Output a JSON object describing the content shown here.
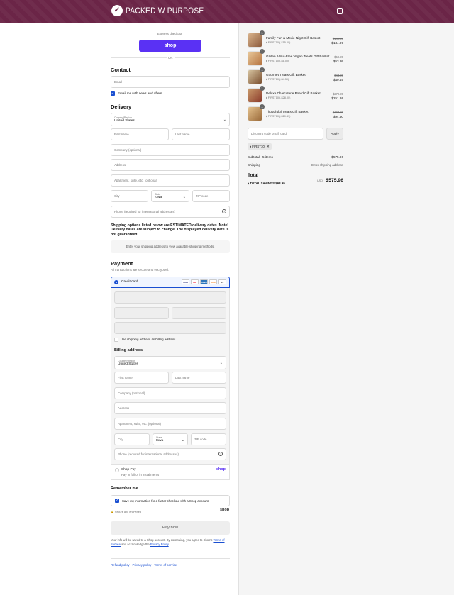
{
  "header": {
    "brand": "PACKED W PURPOSE"
  },
  "express": {
    "label": "Express checkout",
    "shop_button": "shop",
    "or": "OR"
  },
  "contact": {
    "heading": "Contact",
    "email_placeholder": "Email",
    "news_label": "Email me with news and offers"
  },
  "delivery": {
    "heading": "Delivery",
    "country_label": "Country/Region",
    "country_value": "United States",
    "first_name": "First name",
    "last_name": "Last name",
    "company": "Company (optional)",
    "address": "Address",
    "apartment": "Apartment, suite, etc. (optional)",
    "city": "City",
    "state_label": "State",
    "state_value": "Iowa",
    "zip": "ZIP code",
    "phone": "Phone (required for international addresses)"
  },
  "shipping_notice": "Shipping options listed below are ESTIMATED delivery dates. Note! Delivery dates are subject to change. The displayed delivery date is not guaranteed.",
  "shipping_placeholder": "Enter your shipping address to view available shipping methods.",
  "payment": {
    "heading": "Payment",
    "subtext": "All transactions are secure and encrypted.",
    "credit_card": "Credit card",
    "card_brands": [
      "VISA",
      "MC",
      "AMEX",
      "DISC",
      "+4"
    ],
    "use_shipping": "Use shipping address as billing address",
    "billing_heading": "Billing address",
    "shop_pay": "Shop Pay",
    "shop_pay_sub": "Pay in full or in installments",
    "shop_pay_logo": "shop"
  },
  "remember": {
    "heading": "Remember me",
    "save_label": "Save my information for a faster checkout with a Shop account",
    "secure": "Secure and encrypted",
    "shop_logo": "shop"
  },
  "pay_now": "Pay now",
  "legal": {
    "text": "Your info will be saved to a Shop account. By continuing, you agree to Shop's",
    "terms": "Terms of Service",
    "and": "and acknowledge the",
    "privacy": "Privacy Policy",
    "end": "."
  },
  "footer_links": [
    "Refund policy",
    "Privacy policy",
    "Terms of service"
  ],
  "cart": {
    "items": [
      {
        "qty": "1",
        "name": "Family Fun & Movie Night Gift Basket",
        "discount": "FIRST10 (-$15.00)",
        "old": "$149.99",
        "new": "$134.99"
      },
      {
        "qty": "1",
        "name": "Gluten & Nut-Free Vegan Treats Gift Basket",
        "discount": "FIRST10 (-$6.00)",
        "old": "$59.99",
        "new": "$53.99"
      },
      {
        "qty": "1",
        "name": "Gourmet Treats Gift Basket",
        "discount": "FIRST10 (-$4.50)",
        "old": "$44.99",
        "new": "$40.49"
      },
      {
        "qty": "1",
        "name": "Deluxe Charcuterie Board Gift Basket",
        "discount": "FIRST10 (-$28.00)",
        "old": "$279.99",
        "new": "$251.99"
      },
      {
        "qty": "1",
        "name": "Thoughtful Treats Gift Basket",
        "discount": "FIRST10 (-$10.49)",
        "old": "$104.99",
        "new": "$94.50"
      }
    ],
    "discount_placeholder": "Discount code or gift card",
    "apply": "Apply",
    "code_tag": "FIRST10",
    "subtotal_label": "Subtotal · 5 items",
    "subtotal_value": "$575.96",
    "shipping_label": "Shipping",
    "shipping_value": "Enter shipping address",
    "total_label": "Total",
    "total_currency": "USD",
    "total_value": "$575.96",
    "savings_label": "TOTAL SAVINGS",
    "savings_value": "$63.99"
  }
}
